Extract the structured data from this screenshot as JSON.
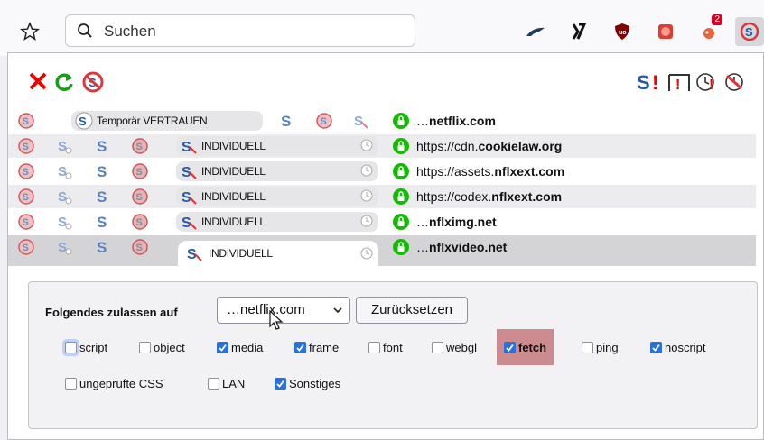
{
  "search": {
    "placeholder": "Suchen"
  },
  "toolbar": {
    "badge_count": "2"
  },
  "rows": [
    {
      "preset": "Temporär VERTRAUEN",
      "site_prefix": "…",
      "site_bold": "netflix.com",
      "site_suffix": ""
    },
    {
      "preset": "INDIVIDUELL",
      "site_prefix": "https://cdn.",
      "site_bold": "cookielaw.org",
      "site_suffix": ""
    },
    {
      "preset": "INDIVIDUELL",
      "site_prefix": "https://assets.",
      "site_bold": "nflxext.com",
      "site_suffix": ""
    },
    {
      "preset": "INDIVIDUELL",
      "site_prefix": "https://codex.",
      "site_bold": "nflxext.com",
      "site_suffix": ""
    },
    {
      "preset": "INDIVIDUELL",
      "site_prefix": "…",
      "site_bold": "nflximg.net",
      "site_suffix": ""
    },
    {
      "preset": "INDIVIDUELL",
      "site_prefix": "…",
      "site_bold": "nflxvideo.net",
      "site_suffix": ""
    }
  ],
  "details": {
    "label": "Folgendes zulassen auf",
    "select_value": "…netflix.com",
    "reset_label": "Zurücksetzen",
    "checkboxes": [
      {
        "label": "script",
        "checked": false
      },
      {
        "label": "object",
        "checked": false
      },
      {
        "label": "media",
        "checked": true
      },
      {
        "label": "frame",
        "checked": true
      },
      {
        "label": "font",
        "checked": false
      },
      {
        "label": "webgl",
        "checked": false
      },
      {
        "label": "fetch",
        "checked": true
      },
      {
        "label": "ping",
        "checked": false
      },
      {
        "label": "noscript",
        "checked": true
      },
      {
        "label": "ungeprüfte CSS",
        "checked": false
      },
      {
        "label": "LAN",
        "checked": false
      },
      {
        "label": "Sonstiges",
        "checked": true
      }
    ]
  },
  "colors": {
    "accent": "#2a71d9",
    "highlight": "#cc8b8e",
    "lock_green": "#12bc00",
    "noscript_blue": "#245aa8"
  }
}
